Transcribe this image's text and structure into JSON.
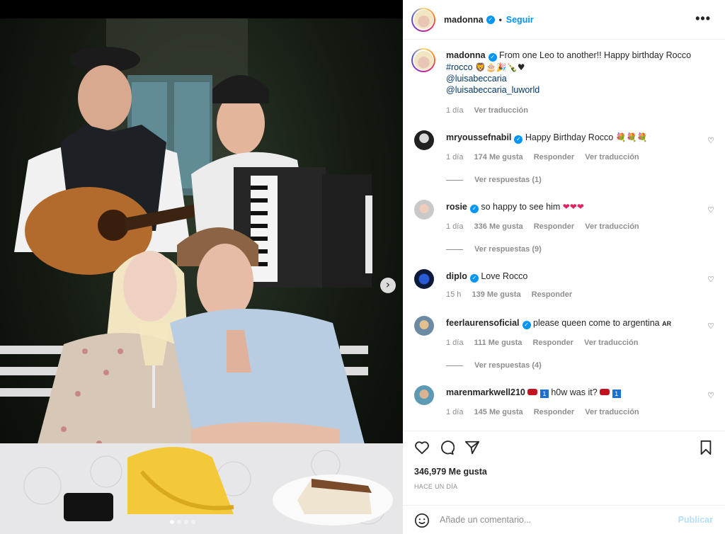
{
  "post": {
    "author": "madonna",
    "follow_label": "Seguir",
    "separator": "•",
    "more_icon": "more-horizontal-icon",
    "caption": {
      "username": "madonna",
      "text": "From one Leo to another!! Happy birthday Rocco",
      "hashtag": "#rocco",
      "emojis": "🦁🎂🎉🍾♥",
      "mention1": "@luisabeccaria",
      "mention2": "@luisabeccaria_luworld",
      "time": "1 día",
      "translate": "Ver traducción"
    }
  },
  "comments": [
    {
      "username": "mryoussefnabil",
      "verified": true,
      "text": "Happy Birthday Rocco",
      "emojis": "💐💐💐",
      "time": "1 día",
      "likes": "174 Me gusta",
      "reply": "Responder",
      "translate": "Ver traducción",
      "replies": "Ver respuestas (1)"
    },
    {
      "username": "rosie",
      "verified": true,
      "text": "so happy to see him",
      "emojis": "❤❤❤",
      "time": "1 día",
      "likes": "336 Me gusta",
      "reply": "Responder",
      "translate": "Ver traducción",
      "replies": "Ver respuestas (9)"
    },
    {
      "username": "diplo",
      "verified": true,
      "text": "Love Rocco",
      "emojis": "",
      "time": "15 h",
      "likes": "139 Me gusta",
      "reply": "Responder",
      "translate": "",
      "replies": ""
    },
    {
      "username": "feerlaurensoficial",
      "verified": true,
      "text": "please queen come to argentina",
      "emojis": "AR",
      "time": "1 día",
      "likes": "111 Me gusta",
      "reply": "Responder",
      "translate": "Ver traducción",
      "replies": "Ver respuestas (4)"
    },
    {
      "username": "marenmarkwell210",
      "verified": false,
      "text": "h0w was it?",
      "emojis": "",
      "time": "1 día",
      "likes": "145 Me gusta",
      "reply": "Responder",
      "translate": "Ver traducción",
      "replies": ""
    }
  ],
  "actions": {
    "likes_count": "346,979 Me gusta",
    "date": "HACE UN DÍA",
    "comment_placeholder": "Añade un comentario...",
    "post_label": "Publicar"
  },
  "carousel": {
    "next_icon": "chevron-right-icon",
    "dot_count": 4,
    "active_dot": 0
  },
  "colors": {
    "accent": "#0095f6",
    "text": "#262626",
    "muted": "#8e8e8e",
    "link": "#00376b",
    "publish_disabled": "#b2dffc"
  }
}
